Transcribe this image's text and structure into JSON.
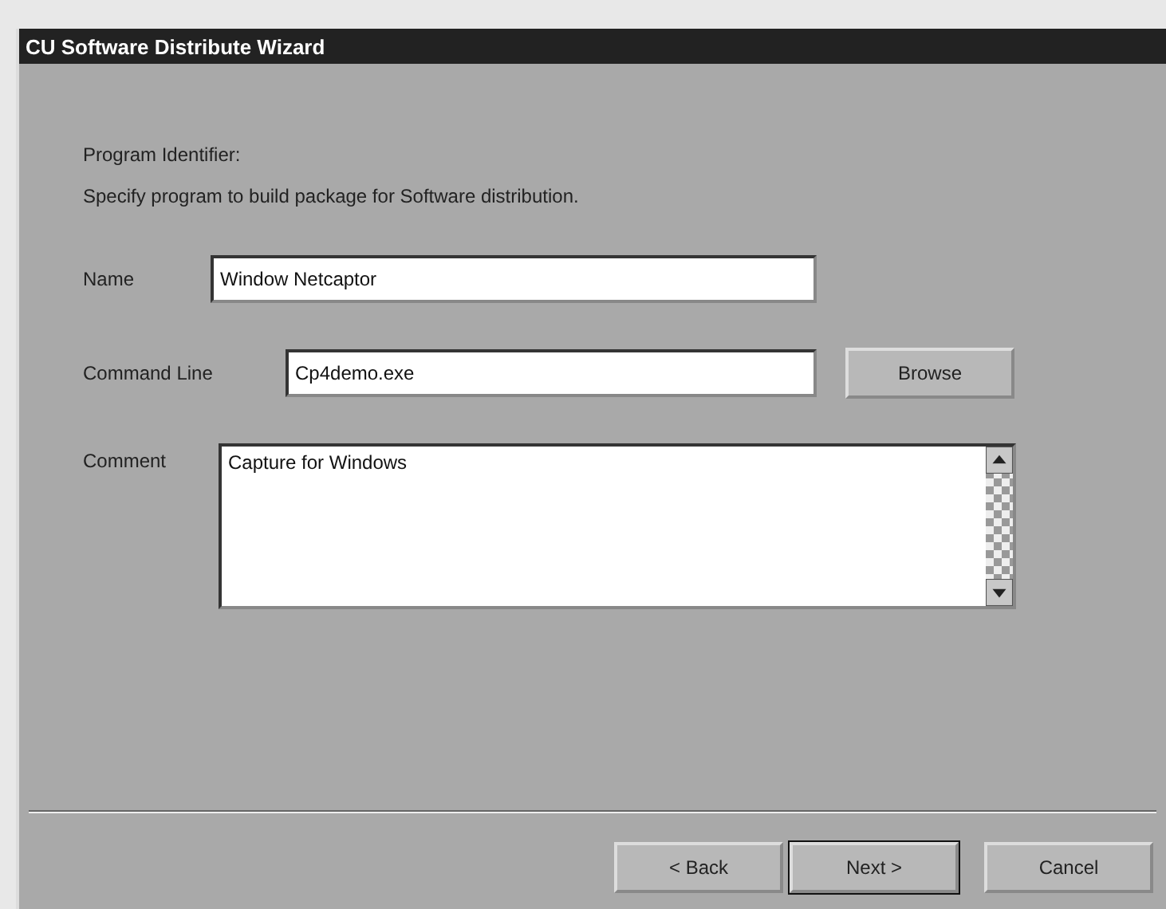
{
  "window": {
    "title": "CU Software Distribute Wizard"
  },
  "heading": "Program Identifier:",
  "description": "Specify program to build package for Software distribution.",
  "fields": [
    {
      "kind": "line",
      "label": "Name",
      "value": "Window Netcaptor"
    },
    {
      "kind": "line",
      "label": "Command Line",
      "value": "Cp4demo.exe",
      "button": "Browse"
    },
    {
      "kind": "multiline",
      "label": "Comment",
      "value": "Capture for Windows"
    }
  ],
  "buttons": [
    {
      "label": "< Back",
      "default": false
    },
    {
      "label": "Next >",
      "default": true
    },
    {
      "label": "Cancel",
      "default": false
    }
  ]
}
